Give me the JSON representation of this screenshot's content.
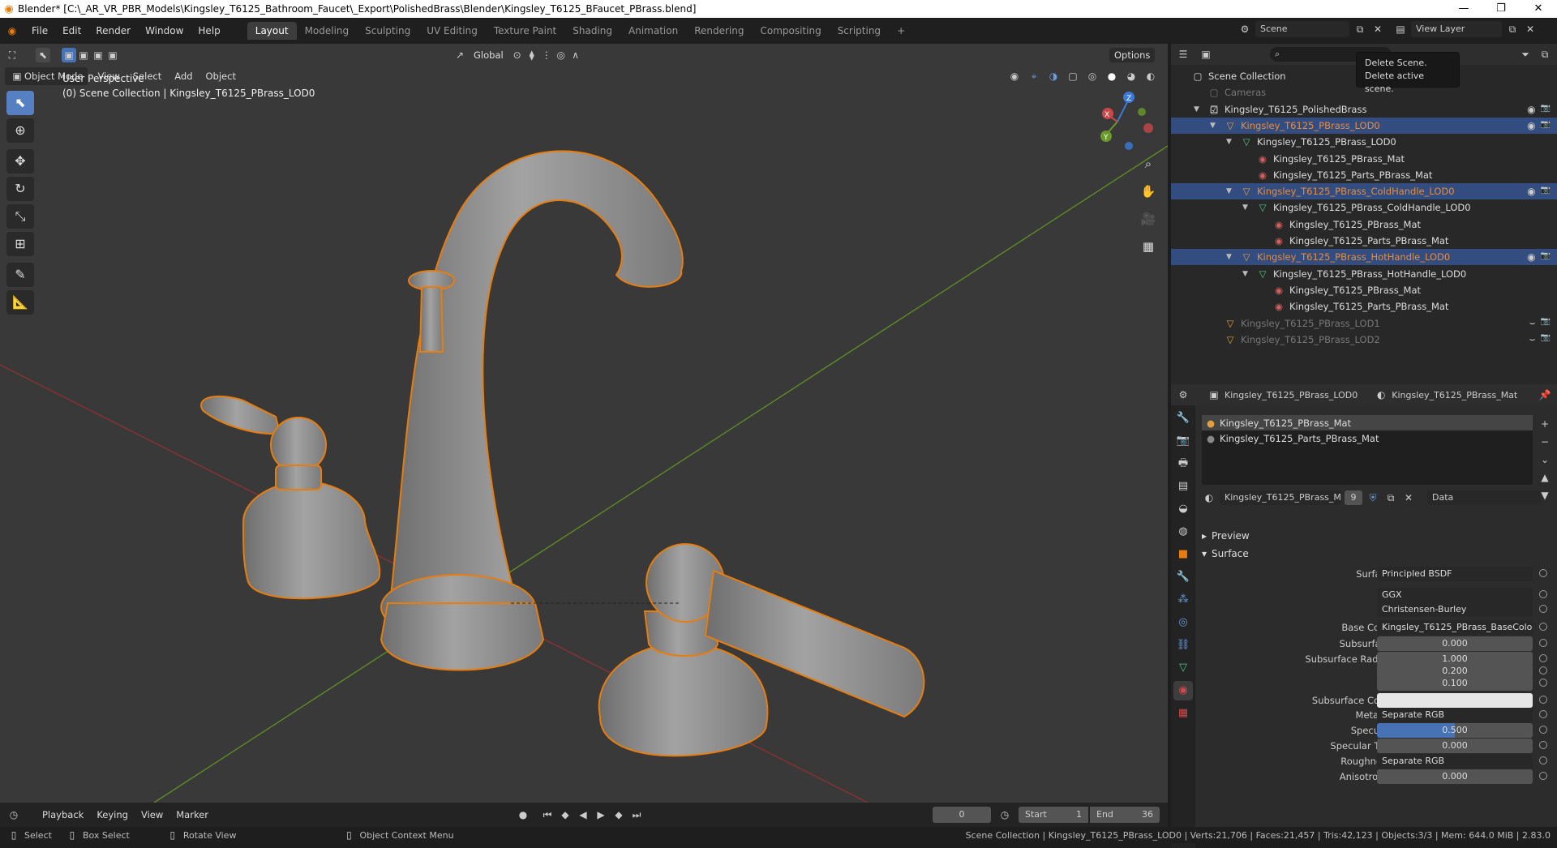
{
  "window": {
    "title": "Blender* [C:\\_AR_VR_PBR_Models\\Kingsley_T6125_Bathroom_Faucet\\_Export\\PolishedBrass\\Blender\\Kingsley_T6125_BFaucet_PBrass.blend]",
    "minimize": "—",
    "maximize": "❐",
    "close": "✕"
  },
  "menus": [
    "File",
    "Edit",
    "Render",
    "Window",
    "Help"
  ],
  "workspaces": [
    {
      "label": "Layout",
      "active": true
    },
    {
      "label": "Modeling"
    },
    {
      "label": "Sculpting"
    },
    {
      "label": "UV Editing"
    },
    {
      "label": "Texture Paint"
    },
    {
      "label": "Shading"
    },
    {
      "label": "Animation"
    },
    {
      "label": "Rendering"
    },
    {
      "label": "Compositing"
    },
    {
      "label": "Scripting"
    }
  ],
  "add_workspace": "+",
  "scene": {
    "label": "Scene",
    "view_layer": "View Layer"
  },
  "viewport": {
    "mode": "Object Mode",
    "menu": [
      "View",
      "Select",
      "Add",
      "Object"
    ],
    "transform_orientation": "Global",
    "options": "Options",
    "overlay_title": "User Perspective",
    "overlay_subtitle": "(0) Scene Collection | Kingsley_T6125_PBrass_LOD0"
  },
  "gizmo": {
    "x": "X",
    "y": "Y",
    "z": "Z"
  },
  "colors": {
    "accent": "#4772b3",
    "selection": "#e87d0d",
    "x_axis": "#a03838",
    "y_axis": "#6a9a2a"
  },
  "tooltip": {
    "line1": "Delete Scene.",
    "line2": "Delete active scene."
  },
  "outliner": {
    "rows": [
      {
        "label": "Scene Collection",
        "indent": 0
      },
      {
        "label": "Cameras",
        "indent": 1,
        "dim": true
      },
      {
        "label": "Kingsley_T6125_PolishedBrass",
        "indent": 1,
        "arrow": "▼",
        "vis": true
      },
      {
        "label": "Kingsley_T6125_PBrass_LOD0",
        "indent": 2,
        "arrow": "▼",
        "sel": true,
        "orange": true,
        "vis": true
      },
      {
        "label": "Kingsley_T6125_PBrass_LOD0",
        "indent": 3,
        "arrow": "▼",
        "kind": "mesh"
      },
      {
        "label": "Kingsley_T6125_PBrass_Mat",
        "indent": 4,
        "kind": "mat"
      },
      {
        "label": "Kingsley_T6125_Parts_PBrass_Mat",
        "indent": 4,
        "kind": "mat"
      },
      {
        "label": "Kingsley_T6125_PBrass_ColdHandle_LOD0",
        "indent": 3,
        "arrow": "▼",
        "sel": true,
        "orange": true,
        "vis": true
      },
      {
        "label": "Kingsley_T6125_PBrass_ColdHandle_LOD0",
        "indent": 4,
        "arrow": "▼",
        "kind": "mesh"
      },
      {
        "label": "Kingsley_T6125_PBrass_Mat",
        "indent": 5,
        "kind": "mat"
      },
      {
        "label": "Kingsley_T6125_Parts_PBrass_Mat",
        "indent": 5,
        "kind": "mat"
      },
      {
        "label": "Kingsley_T6125_PBrass_HotHandle_LOD0",
        "indent": 3,
        "arrow": "▼",
        "sel": true,
        "orange": true,
        "vis": true
      },
      {
        "label": "Kingsley_T6125_PBrass_HotHandle_LOD0",
        "indent": 4,
        "arrow": "▼",
        "kind": "mesh"
      },
      {
        "label": "Kingsley_T6125_PBrass_Mat",
        "indent": 5,
        "kind": "mat"
      },
      {
        "label": "Kingsley_T6125_Parts_PBrass_Mat",
        "indent": 5,
        "kind": "mat"
      },
      {
        "label": "Kingsley_T6125_PBrass_LOD1",
        "indent": 2,
        "dim": true,
        "hidden": true
      },
      {
        "label": "Kingsley_T6125_PBrass_LOD2",
        "indent": 2,
        "dim": true,
        "hidden": true
      }
    ]
  },
  "properties": {
    "object": "Kingsley_T6125_PBrass_LOD0",
    "material": "Kingsley_T6125_PBrass_Mat",
    "slots": [
      "Kingsley_T6125_PBrass_Mat",
      "Kingsley_T6125_Parts_PBrass_Mat"
    ],
    "mat_name": "Kingsley_T6125_PBrass_Mat",
    "users": "9",
    "link": "Data",
    "sections": {
      "preview": "Preview",
      "surface": "Surface"
    },
    "fields": [
      {
        "label": "Surface",
        "value": "Principled BSDF",
        "type": "dd"
      },
      {
        "label": "",
        "value": "GGX",
        "type": "dd"
      },
      {
        "label": "",
        "value": "Christensen-Burley",
        "type": "dd"
      },
      {
        "label": "Base Color",
        "value": "Kingsley_T6125_PBrass_BaseColor...",
        "type": "dd"
      },
      {
        "label": "Subsurface",
        "value": "0.000"
      },
      {
        "label": "Subsurface Radius",
        "value": "1.000"
      },
      {
        "label": "",
        "value": "0.200"
      },
      {
        "label": "",
        "value": "0.100"
      },
      {
        "label": "Subsurface Color",
        "value": "",
        "type": "white"
      },
      {
        "label": "Metallic",
        "value": "Separate RGB",
        "type": "dd"
      },
      {
        "label": "Specular",
        "value": "0.500",
        "type": "blue",
        "fraction": 0.5
      },
      {
        "label": "Specular Tint",
        "value": "0.000"
      },
      {
        "label": "Roughness",
        "value": "Separate RGB",
        "type": "dd"
      },
      {
        "label": "Anisotropic",
        "value": "0.000"
      }
    ]
  },
  "timeline": {
    "menu": [
      "Playback",
      "Keying",
      "View",
      "Marker"
    ],
    "frame": "0",
    "start_label": "Start",
    "start": "1",
    "end_label": "End",
    "end": "36"
  },
  "status": {
    "select": "Select",
    "box_select": "Box Select",
    "rotate": "Rotate View",
    "context": "Object Context Menu",
    "stats": "Scene Collection | Kingsley_T6125_PBrass_LOD0 | Verts:21,706 | Faces:21,457 | Tris:42,123 | Objects:3/3 | Mem: 644.0 MiB | 2.83.0"
  }
}
